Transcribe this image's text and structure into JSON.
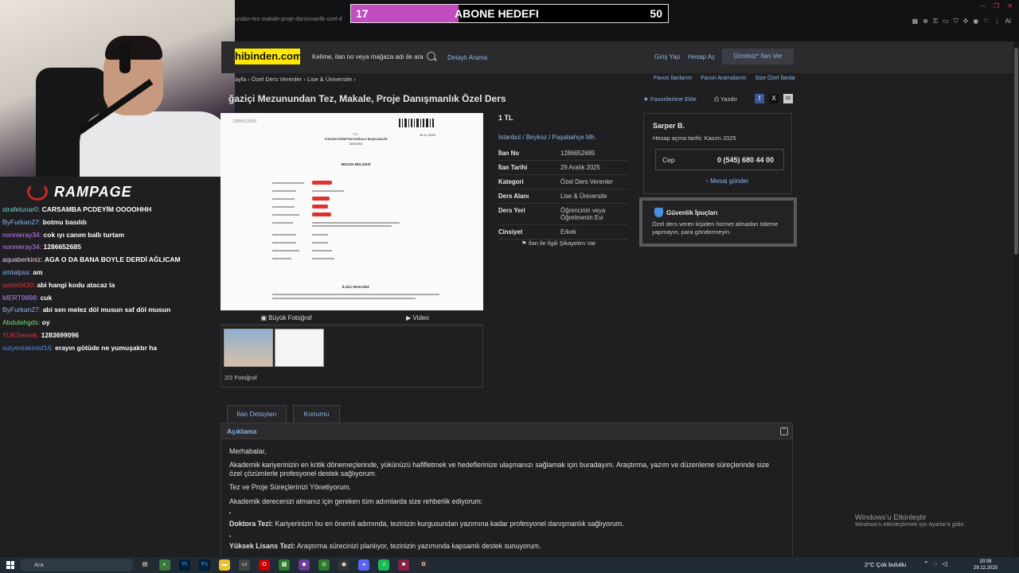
{
  "browser": {
    "url_fragment": "undan-tez-makale-proje-danismanlik-ozel-d",
    "ext_icons": [
      "grid-icon",
      "zoom-icon",
      "key-icon",
      "cast-icon",
      "shield-icon",
      "extension-icon",
      "spotify-icon",
      "heart-icon",
      "settings-icon"
    ],
    "ai_label": "AI"
  },
  "overlay": {
    "abone_current": "17",
    "abone_title": "ABONE HEDEFI",
    "abone_goal": "50",
    "abone_progress": 0.34,
    "abone_color": "#c04cc0",
    "brand": "RAMPAGE"
  },
  "chat": [
    {
      "user": "strafelunar0:",
      "color": "#6fd3d3",
      "msg": "CARSAMBA PCDEYİM OOOOHHH"
    },
    {
      "user": "ByFurkan27:",
      "color": "#8ab4f8",
      "msg": "botmu basıldı"
    },
    {
      "user": "nonnieray34:",
      "color": "#c77cff",
      "msg": "cok ıyı canım ballı turtam"
    },
    {
      "user": "nonnieray34:",
      "color": "#c77cff",
      "msg": "1286652685"
    },
    {
      "user": "aquaberkiniz:",
      "color": "#f3c8e8",
      "msg": "AGA O DA BANA BOYLE DERDİ AĞLICAM"
    },
    {
      "user": "smtalpss:",
      "color": "#8ab4f8",
      "msg": "am"
    },
    {
      "user": "walte0430:",
      "color": "#e03030",
      "msg": "abi hangi kodu atacaz la"
    },
    {
      "user": "MERT9898:",
      "color": "#c77cff",
      "msg": "cuk"
    },
    {
      "user": "ByFurkan27:",
      "color": "#8ab4f8",
      "msg": "abi sen melez döl musun saf döl musun"
    },
    {
      "user": "Abdulahgds:",
      "color": "#7cd67c",
      "msg": "oy"
    },
    {
      "user": "YUKSemek:",
      "color": "#e03030",
      "msg": "1283699096"
    },
    {
      "user": "sutyentakmisf16:",
      "color": "#4f8be8",
      "msg": "erayın götüde ne yumuşaktır ha"
    }
  ],
  "header": {
    "logo": "hibinden.com",
    "search_placeholder": "Kelime, ilan no veya mağaza adı ile ara",
    "detayli_arama": "Detaylı Arama",
    "giris": "Giriş Yap",
    "hesap_ac": "Hesap Aç",
    "ilan_ver": "Ücretsiz* İlan Ver"
  },
  "breadcrumb": [
    "ayfa",
    "Özel Ders Verenler",
    "Lise & Üniversite"
  ],
  "top_links": [
    "Favori İlanlarım",
    "Favori Aramalarım",
    "Size Özel İlanlar"
  ],
  "listing": {
    "title": "ğaziçi Mezunundan Tez, Makale, Proje Danışmanlık Özel Ders",
    "favorite": "Favorilerime Ekle",
    "print": "Yazdır",
    "price": "1 TL",
    "location": [
      "İstanbul",
      "Beykoz",
      "Paşabahçe Mh."
    ],
    "info": [
      {
        "k": "İlan No",
        "v": "1286652685"
      },
      {
        "k": "İlan Tarihi",
        "v": "29 Aralık 2025"
      },
      {
        "k": "Kategori",
        "v": "Özel Ders Verenler"
      },
      {
        "k": "Ders Alanı",
        "v": "Lise & Üniversite"
      },
      {
        "k": "Ders Yeri",
        "v": "Öğrencinin veya Öğretmenin Evi"
      },
      {
        "k": "Cinsiyet",
        "v": "Erkek"
      }
    ],
    "report": "İlan ile İlgili Şikayetim Var",
    "big_photo": "Büyük Fotoğraf",
    "video": "Video",
    "photo_count": "2/2 Fotoğraf"
  },
  "document": {
    "ref": "286652685",
    "header1": "T.C.",
    "header2": "YÜKSEKÖĞRETİM KURULU BAŞKANLIĞI",
    "header3": "ANKARA",
    "date": "30.11.2025",
    "doc_title": "MEZUN BELGESİ",
    "footer": "İLGİLİ MAKAMA"
  },
  "seller": {
    "name": "Sarper B.",
    "since": "Hesap açma tarihi: Kasım 2025",
    "phone_label": "Cep",
    "phone": "0 (545) 680 44 00",
    "message": "Mesaj gönder"
  },
  "security": {
    "title": "Güvenlik İpuçları",
    "text": "Özel ders veren kişiden hizmet almadan ödeme yapmayın, para göndermeyin."
  },
  "tabs": [
    "İlan Detayları",
    "Konumu"
  ],
  "description": {
    "title": "Açıklama",
    "p1": "Merhabalar,",
    "p2": "Akademik kariyerinizin en kritik dönemeçlerinde, yükünüzü hafifletmek ve hedeflerinize ulaşmanızı sağlamak için buradayım. Araştırma, yazım ve düzenleme süreçlerinde size özel çözümlerle profesyonel destek sağlıyorum.",
    "p3": "Tez ve Proje Süreçlerinizi Yönetiyorum.",
    "p4": "Akademik derecenizi almanız için gereken tüm adımlarda size rehberlik ediyorum:",
    "b1": "Doktora Tezi:",
    "b1t": "Kariyerinizin bu en önemli adımında, tezinizin kurgusundan yazımına kadar profesyonel danışmanlık sağlıyorum.",
    "b2": "Yüksek Lisans Tezi:",
    "b2t": "Araştırma sürecinizi planlıyor, tezinizin yazımında kapsamlı destek sunuyorum."
  },
  "windows": {
    "activate_title": "Windows'u Etkinleştir",
    "activate_sub": "Windows'u etkinleştirmek için Ayarlar'a gidin."
  },
  "taskbar": {
    "search": "Ara",
    "weather": "2°C  Çok bulutlu",
    "time": "20:08",
    "date": "29.12.2025"
  }
}
